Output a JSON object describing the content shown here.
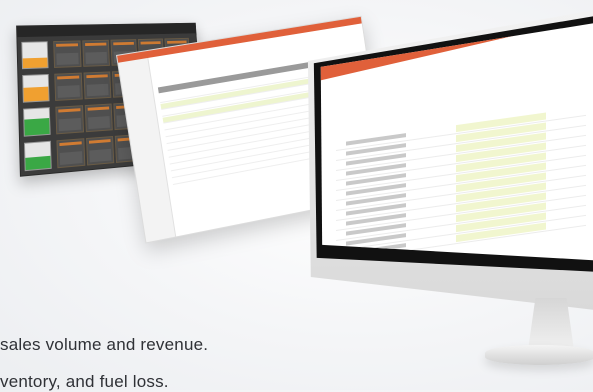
{
  "caption": {
    "line1": "sales volume and revenue.",
    "line2": "ventory, and fuel loss."
  },
  "colors": {
    "accent": "#e0603a",
    "dashboard_dark": "#3b3b3b",
    "highlight_row": "#eef5cf"
  },
  "icons": [
    "monitor-stand-icon"
  ]
}
